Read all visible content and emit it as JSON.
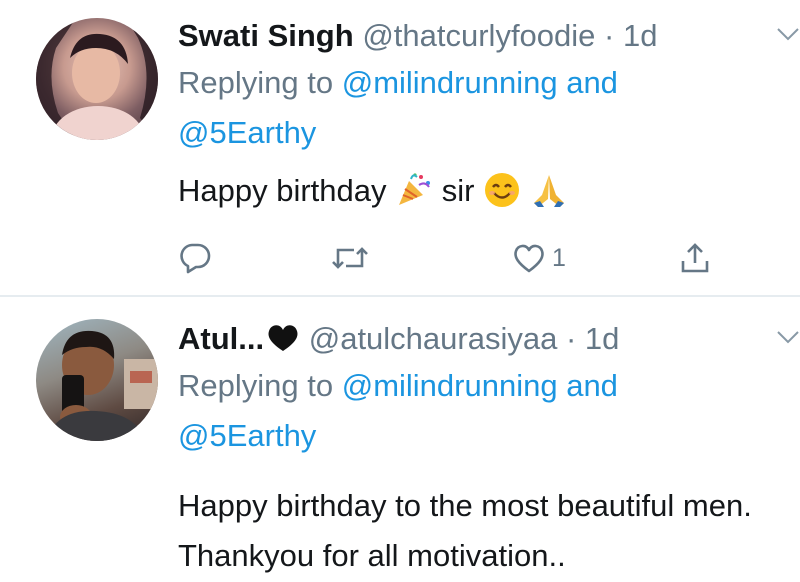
{
  "tweets": [
    {
      "name": "Swati Singh",
      "handle": "@thatcurlyfoodie",
      "separator": "·",
      "time": "1d",
      "replying_prefix": "Replying to",
      "replying_mention1": "@milindrunning",
      "replying_and": "and",
      "replying_mention2": "@5Earthy",
      "text_part1": "Happy birthday",
      "text_part2": "sir",
      "emojis": [
        "party-popper-icon",
        "smiling-face-icon",
        "folded-hands-icon"
      ],
      "like_count": "1"
    },
    {
      "name": "Atul...",
      "name_emoji": "black-heart-icon",
      "handle": "@atulchaurasiyaa",
      "separator": "·",
      "time": "1d",
      "replying_prefix": "Replying to",
      "replying_mention1": "@milindrunning",
      "replying_and": "and",
      "replying_mention2": "@5Earthy",
      "text": "Happy birthday to the most beautiful men. Thankyou for all motivation.."
    }
  ],
  "colors": {
    "link": "#1b95e0",
    "secondary": "#657786",
    "text": "#14171a",
    "divider": "#e6ecf0"
  }
}
